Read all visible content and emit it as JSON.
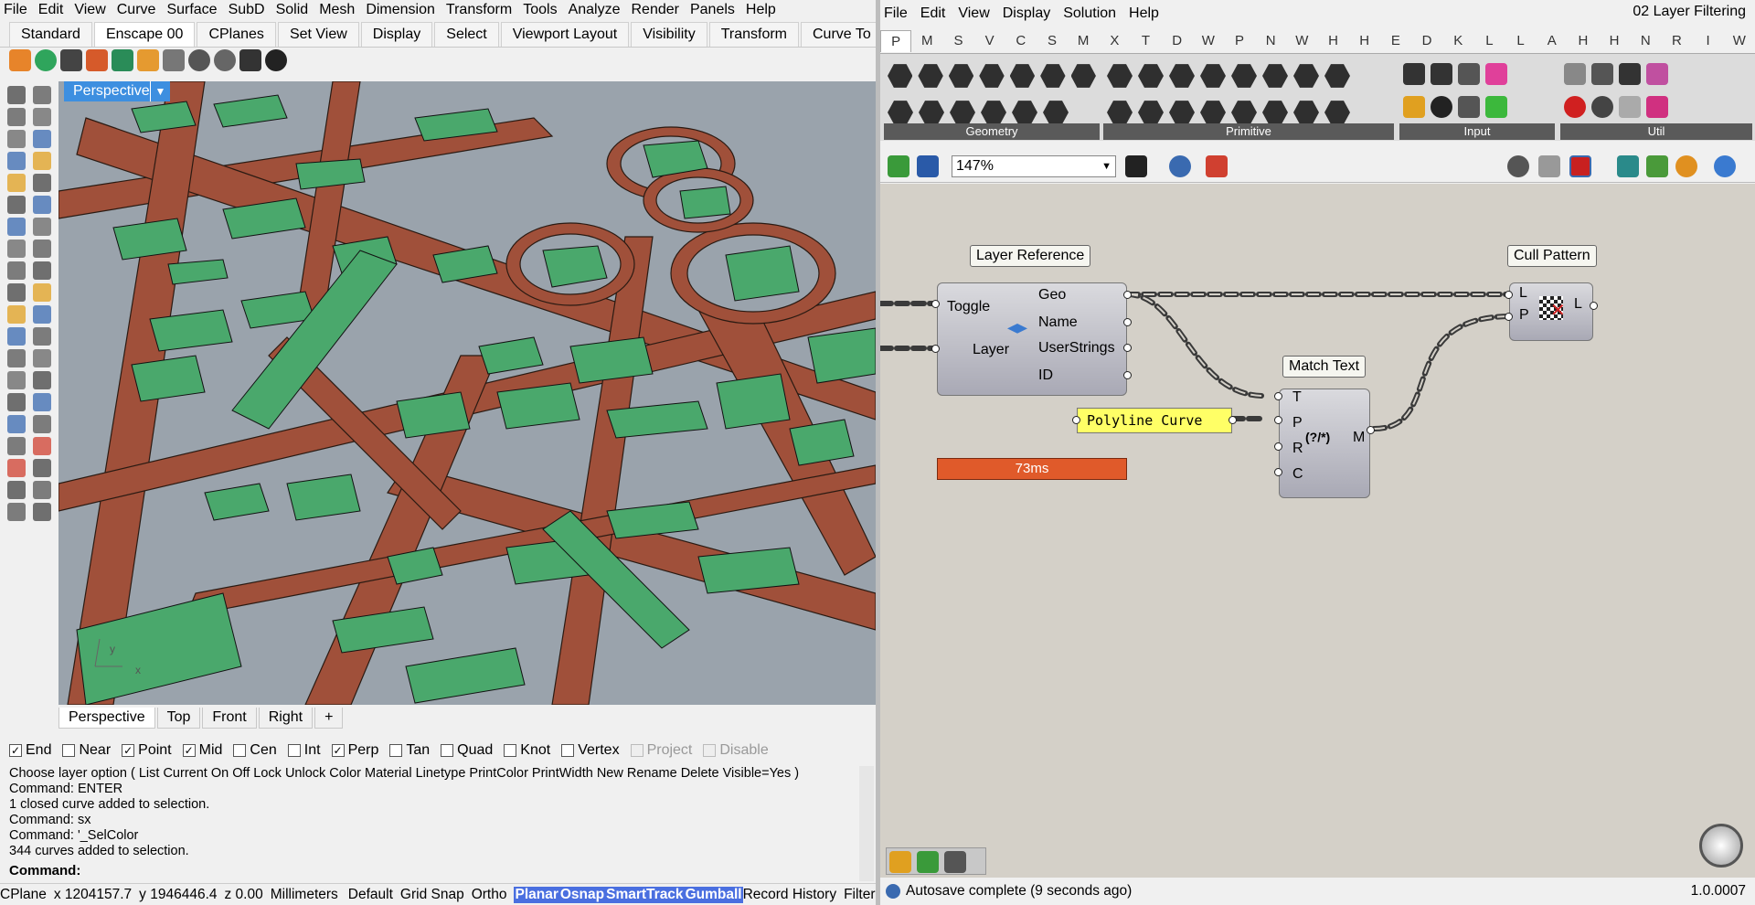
{
  "rhino": {
    "menu": [
      "File",
      "Edit",
      "View",
      "Curve",
      "Surface",
      "SubD",
      "Solid",
      "Mesh",
      "Dimension",
      "Transform",
      "Tools",
      "Analyze",
      "Render",
      "Panels",
      "Help"
    ],
    "toolbar_tabs": [
      "Standard",
      "Enscape 00",
      "CPlanes",
      "Set View",
      "Display",
      "Select",
      "Viewport Layout",
      "Visibility",
      "Transform",
      "Curve To"
    ],
    "active_tab": "Enscape 00",
    "viewport_label": "Perspective",
    "view_tabs": [
      "Perspective",
      "Top",
      "Front",
      "Right"
    ],
    "view_add": "+",
    "axis": {
      "x": "x",
      "y": "y"
    },
    "osnaps": [
      {
        "label": "End",
        "checked": true
      },
      {
        "label": "Near",
        "checked": false
      },
      {
        "label": "Point",
        "checked": true
      },
      {
        "label": "Mid",
        "checked": true
      },
      {
        "label": "Cen",
        "checked": false
      },
      {
        "label": "Int",
        "checked": false
      },
      {
        "label": "Perp",
        "checked": true
      },
      {
        "label": "Tan",
        "checked": false
      },
      {
        "label": "Quad",
        "checked": false
      },
      {
        "label": "Knot",
        "checked": false
      },
      {
        "label": "Vertex",
        "checked": false
      },
      {
        "label": "Project",
        "checked": false,
        "disabled": true
      },
      {
        "label": "Disable",
        "checked": false,
        "disabled": true
      }
    ],
    "command_history": [
      "Choose layer option ( List  Current  On  Off  Lock  Unlock  Color  Material  Linetype  PrintColor  PrintWidth  New  Rename  Delete  Visible=Yes )",
      "Command: ENTER",
      "1 closed curve added to selection.",
      "Command: sx",
      "Command: '_SelColor",
      "344 curves added to selection."
    ],
    "command_prompt": "Command:",
    "status": {
      "cplane": "CPlane",
      "coords": "x 1204157.7",
      "coords_y": "y 1946446.4",
      "z": "z 0.00",
      "units": "Millimeters",
      "layer": "Default",
      "layer_color": "#111111",
      "toggles": [
        {
          "label": "Grid Snap",
          "on": false
        },
        {
          "label": "Ortho",
          "on": false
        },
        {
          "label": "Planar",
          "on": true
        },
        {
          "label": "Osnap",
          "on": true
        },
        {
          "label": "SmartTrack",
          "on": true
        },
        {
          "label": "Gumball",
          "on": true
        },
        {
          "label": "Record History",
          "on": false
        },
        {
          "label": "Filter",
          "on": false
        }
      ]
    },
    "colors": {
      "road": "#a0503a",
      "building": "#4aa86c",
      "ground": "#9aa3ac",
      "viewport_tab": "#3d8fe0"
    }
  },
  "gh": {
    "menu": [
      "File",
      "Edit",
      "View",
      "Display",
      "Solution",
      "Help"
    ],
    "title": "02 Layer Filtering",
    "component_tabs": [
      "P",
      "M",
      "S",
      "V",
      "C",
      "S",
      "M",
      "X",
      "T",
      "D",
      "W",
      "P",
      "N",
      "W",
      "H",
      "H",
      "E",
      "D",
      "K",
      "L",
      "L",
      "A",
      "H",
      "H",
      "N",
      "R",
      "I",
      "W"
    ],
    "active_component_tab": "P",
    "groups": [
      "Geometry",
      "Primitive",
      "Input",
      "Util"
    ],
    "zoom": "147%",
    "nodes": {
      "layer_ref": {
        "title": "Layer Reference",
        "inputs": [
          "Toggle",
          "Layer"
        ],
        "outputs": [
          "Geo",
          "Name",
          "UserStrings",
          "ID"
        ],
        "timing": "73ms"
      },
      "match_text": {
        "title": "Match Text",
        "inputs": [
          "T",
          "P",
          "R",
          "C"
        ],
        "outputs": [
          "M"
        ],
        "symbol": "(?/*)"
      },
      "cull_pattern": {
        "title": "Cull Pattern",
        "inputs": [
          "L",
          "P"
        ],
        "outputs": [
          "L"
        ]
      },
      "panel": {
        "text": "Polyline Curve"
      }
    },
    "colors": {
      "canvas": "#d4d0c8",
      "panel": "#ffff66",
      "timing": "#e05a2a"
    },
    "status": {
      "message": "Autosave complete (9 seconds ago)",
      "version": "1.0.0007"
    }
  }
}
